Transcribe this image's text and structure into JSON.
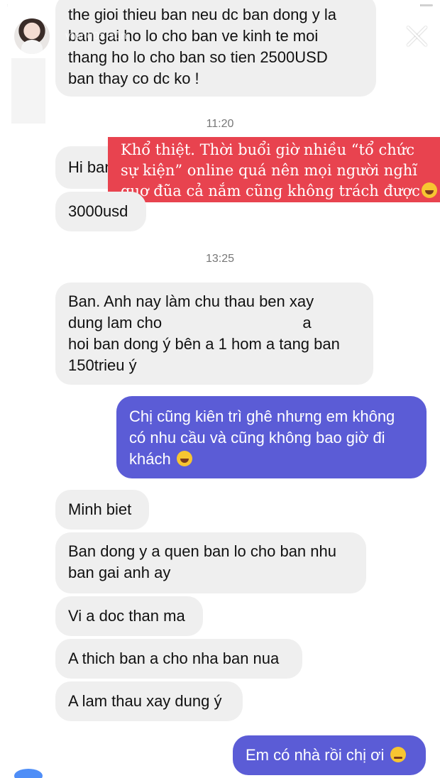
{
  "story": {
    "username": "vtpng0a.sqn",
    "progress": 0.97
  },
  "timestamps": {
    "first": "11:20",
    "second": "13:25"
  },
  "overlay_caption": {
    "line1": "Khổ thiệt. Thời buổi giờ nhiều “tổ chức",
    "line2": "sự kiện” online quá nên mọi người nghĩ",
    "line3": "quơ đũa cả nắm cũng không trách được"
  },
  "messages": {
    "m1_l1": "the gioi thieu ban neu dc ban dong y la",
    "m1_l2": "ban gai ho lo cho ban ve kinh te moi",
    "m1_l3": "thang ho lo cho ban so tien 2500USD",
    "m1_l4": "ban thay co dc ko !",
    "m2": "Hi ban",
    "m3": "3000usd",
    "m4_l1": "Ban. Anh nay làm chu thau ben xay",
    "m4_l2a": "dung lam cho",
    "m4_l2b": "a",
    "m4_l3": "hoi ban dong ý  bên a 1 hom a tang ban",
    "m4_l4": "150trieu ý",
    "m5_l1": "Chị cũng kiên trì ghê nhưng em không",
    "m5_l2": "có nhu cầu và cũng không bao giờ đi",
    "m5_l3": "khách",
    "m6": "Minh biet",
    "m7_l1": "Ban dong y a quen ban lo cho ban nhu",
    "m7_l2": "ban gai anh ay",
    "m8": "Vi a doc than ma",
    "m9": "A thich ban a cho nha ban nua",
    "m10": "A lam thau xay dung ý",
    "m11": "Em có nhà rồi chị ơi"
  },
  "colors": {
    "incoming_bg": "#efefef",
    "outgoing_bg": "#5b5cd6",
    "overlay_bg": "#e8434f"
  },
  "icons": [
    "close-icon",
    "grinning-emoji",
    "laughing-emoji",
    "crying-emoji"
  ]
}
